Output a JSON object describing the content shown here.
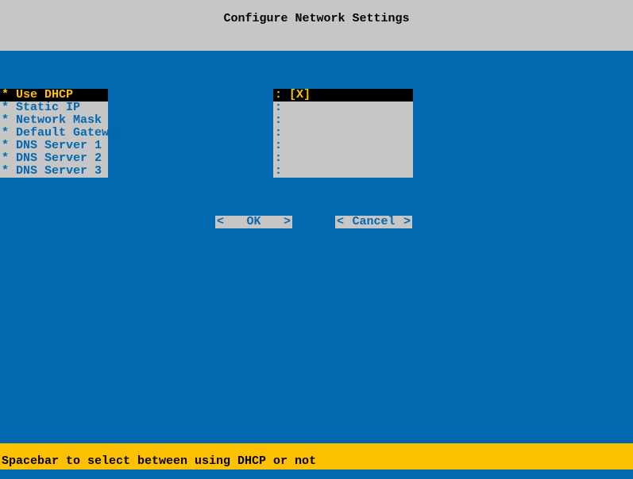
{
  "header": {
    "title": "Configure Network Settings"
  },
  "menu": {
    "items": [
      {
        "prefix": "*",
        "label": "Use DHCP",
        "selected": true
      },
      {
        "prefix": "*",
        "label": "Static IP",
        "selected": false
      },
      {
        "prefix": "*",
        "label": "Network Mask",
        "selected": false
      },
      {
        "prefix": "*",
        "label": "Default Gateway",
        "selected": false
      },
      {
        "prefix": "*",
        "label": "DNS Server 1",
        "selected": false
      },
      {
        "prefix": "*",
        "label": "DNS Server 2",
        "selected": false
      },
      {
        "prefix": "*",
        "label": "DNS Server 3",
        "selected": false
      }
    ]
  },
  "values": {
    "items": [
      {
        "prefix": ":",
        "value": "[X]",
        "selected": true
      },
      {
        "prefix": ":",
        "value": "",
        "selected": false
      },
      {
        "prefix": ":",
        "value": "",
        "selected": false
      },
      {
        "prefix": ":",
        "value": "",
        "selected": false
      },
      {
        "prefix": ":",
        "value": "",
        "selected": false
      },
      {
        "prefix": ":",
        "value": "",
        "selected": false
      },
      {
        "prefix": ":",
        "value": "",
        "selected": false
      }
    ]
  },
  "buttons": {
    "ok": {
      "label": "OK",
      "left": "<",
      "right": ">"
    },
    "cancel": {
      "label": "Cancel",
      "left": "<",
      "right": ">"
    }
  },
  "status": {
    "text": "Spacebar to select between using DHCP or not"
  }
}
